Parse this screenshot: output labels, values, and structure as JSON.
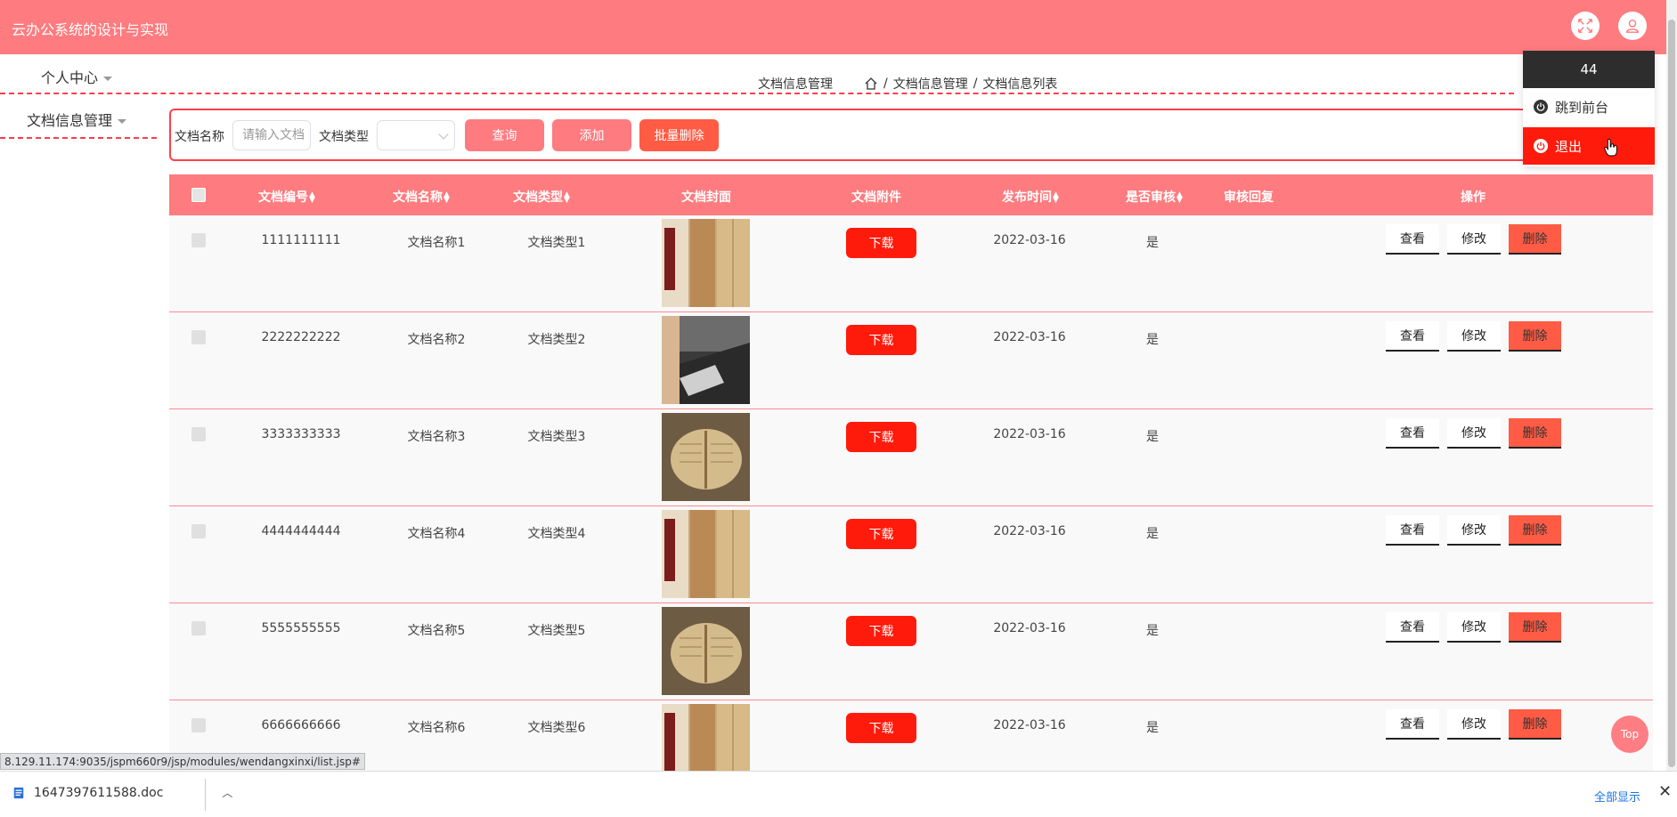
{
  "header": {
    "title": "云办公系统的设计与实现"
  },
  "nav": {
    "items": [
      {
        "label": "个人中心"
      },
      {
        "label": "文档信息管理"
      }
    ]
  },
  "breadcrumb": {
    "section": "文档信息管理",
    "sep": "/",
    "level1": "文档信息管理",
    "level2": "文档信息列表"
  },
  "search": {
    "name_label": "文档名称",
    "name_placeholder": "请输入文档",
    "type_label": "文档类型",
    "query_button": "查询",
    "add_button": "添加",
    "batch_delete_button": "批量删除"
  },
  "table": {
    "columns": [
      "文档编号",
      "文档名称",
      "文档类型",
      "文档封面",
      "文档附件",
      "发布时间",
      "是否审核",
      "审核回复",
      "操作"
    ],
    "download_label": "下载",
    "action_view": "查看",
    "action_edit": "修改",
    "action_delete": "删除",
    "rows": [
      {
        "id": "1111111111",
        "name": "文档名称1",
        "type": "文档类型1",
        "time": "2022-03-16",
        "audited": "是",
        "reply": ""
      },
      {
        "id": "2222222222",
        "name": "文档名称2",
        "type": "文档类型2",
        "time": "2022-03-16",
        "audited": "是",
        "reply": ""
      },
      {
        "id": "3333333333",
        "name": "文档名称3",
        "type": "文档类型3",
        "time": "2022-03-16",
        "audited": "是",
        "reply": ""
      },
      {
        "id": "4444444444",
        "name": "文档名称4",
        "type": "文档类型4",
        "time": "2022-03-16",
        "audited": "是",
        "reply": ""
      },
      {
        "id": "5555555555",
        "name": "文档名称5",
        "type": "文档类型5",
        "time": "2022-03-16",
        "audited": "是",
        "reply": ""
      },
      {
        "id": "6666666666",
        "name": "文档名称6",
        "type": "文档类型6",
        "time": "2022-03-16",
        "audited": "是",
        "reply": ""
      }
    ]
  },
  "user_menu": {
    "username": "44",
    "goto_front": "跳到前台",
    "logout": "退出"
  },
  "status_url": "8.129.11.174:9035/jspm660r9/jsp/modules/wendangxinxi/list.jsp#",
  "top_button": "Top",
  "downloads": {
    "file": "1647397611588.doc",
    "show_all": "全部显示"
  },
  "colors": {
    "header": "#fe7b7f",
    "accent": "#ff3e4d",
    "download_button": "#ff1b0c",
    "delete_button": "#ff5b45",
    "logout_active": "#ff1b0c"
  }
}
